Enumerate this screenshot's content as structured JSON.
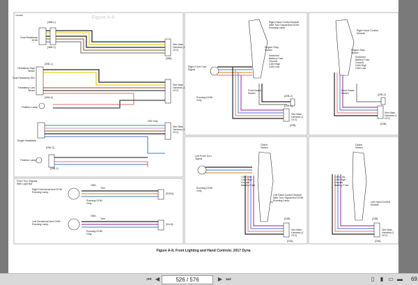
{
  "document": {
    "page_code": "m00006",
    "caption": "Figure A-8. Front Lighting and Hand Controls: 2017 Dyna",
    "left_panel": {
      "title_watermark": "Figure A-8",
      "connectors": [
        "[38B-1]",
        "[38B-2]",
        "[38B-3]",
        "[38B-4]",
        "[39B-1]",
        "[39B-2]",
        "[39B-3]",
        "[39A-6]",
        "[39B-6]",
        "[29A-2]",
        "[29B-2]",
        "[29A-1]",
        "[29B-1]",
        "[38B]"
      ],
      "labels": {
        "dual_headlamp": "Dual Headlamp DOM",
        "headlamp_high": "Headlamp High Beam",
        "dual_headlamp_2": "Dual Headlamp HID",
        "headlamp_low": "Headlamp Low Beam",
        "position_lamp": "Position Lamp",
        "single_headlamp": "Single Headlamp",
        "position_lamp_2": "Position Lamp",
        "see_main_1": "See Main Harness (1 Of 2)",
        "see_main_2": "See Main Harness (1 Of 2)",
        "see_main_3": "See Main Harness (1 Of 2)",
        "hid_only": "HID Only"
      }
    },
    "lower_left": {
      "title": "Front Turn Signals With Light Bar",
      "right_label": "Right Directional And DOM Running Lamp",
      "left_label": "Left Directional And DOM Running Lamp",
      "running_dom": "Running DOM Only",
      "running_dom_2": "Running DOM Only",
      "conn_tags": [
        "[31RA]",
        "[31LA]",
        "[31R]",
        "[31L]"
      ],
      "wire_tags": [
        "GND",
        "Turn",
        "Run",
        "GND",
        "Turn",
        "Run"
      ]
    },
    "panel_tm": {
      "right_hand_control": "Right Hand Control Module With Turn Signal And DOM Running Lamp",
      "engine_stop": "Engine Stop Switch",
      "right_front_turn": "Right Front Turn Signal",
      "running_dom": "Running DOM Only",
      "front_brake": "Front Brake Switch",
      "wires": [
        "Switched",
        "Battery Fuse",
        "Ground",
        "CAN High",
        "CAN Low"
      ],
      "connectors": [
        "[22B-2]",
        "[22B-1]",
        "[22B]"
      ],
      "see_main": "See Main Harness (1 Of 2)"
    },
    "panel_tr": {
      "right_hand_control": "Right Hand Control Module",
      "engine_stop": "Engine Stop Switch",
      "front_brake": "Front Brake Switch",
      "wires": [
        "Switched",
        "Battery Fuse",
        "Ground",
        "CAN High",
        "CAN Low"
      ],
      "connectors": [
        "[22B-2]",
        "[22B-1]",
        "[22B]"
      ],
      "see_main": "See Main Harness (1 Of 2)"
    },
    "panel_bm": {
      "left_front_turn": "Left Front Turn Signal",
      "clutch_switch": "Clutch Switch",
      "left_hand_control": "Left Hand Control Module With Turn Signal And DOM Running Lamp",
      "running_dom": "Running DOM Only",
      "wires": [
        "CAN Low",
        "CAN High",
        "Ground",
        "Battery Fuse"
      ],
      "connectors": [
        "[24B]",
        "[24A]"
      ],
      "see_main": "See Main Harness (1 Of 2)"
    },
    "panel_br": {
      "clutch_switch": "Clutch Switch",
      "left_hand_control": "Left Hand Control Module",
      "wires": [
        "CAN Low",
        "CAN High",
        "Ground",
        "Battery Fuse"
      ],
      "connectors": [
        "[24B]",
        "[24A]"
      ],
      "see_main": "See Main Harness (1 Of 2)"
    }
  },
  "viewer": {
    "page_indicator": "526 / 576",
    "zoom": "69",
    "icons": [
      "first-page-icon",
      "prev-page-icon",
      "next-page-icon",
      "last-page-icon",
      "single-page-icon",
      "two-page-icon",
      "fit-width-icon",
      "fit-page-icon"
    ]
  }
}
